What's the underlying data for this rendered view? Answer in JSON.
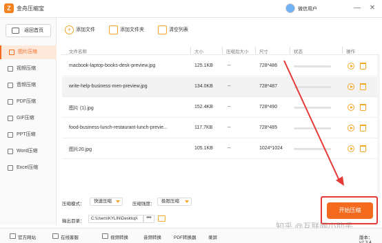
{
  "app": {
    "title": "金舟压缩宝",
    "logo_text": "Z"
  },
  "user": {
    "name": "微信用户"
  },
  "window_controls": {
    "minimize": "—",
    "close": "✕"
  },
  "sidebar": {
    "back_label": "返回首页",
    "items": [
      {
        "label": "图片压缩",
        "active": true
      },
      {
        "label": "视频压缩"
      },
      {
        "label": "音频压缩"
      },
      {
        "label": "PDF压缩"
      },
      {
        "label": "GIF压缩"
      },
      {
        "label": "PPT压缩"
      },
      {
        "label": "Word压缩"
      },
      {
        "label": "Excel压缩"
      }
    ]
  },
  "toolbar": {
    "add_file": "添加文件",
    "add_folder": "添加文件夹",
    "clear_list": "清空列表"
  },
  "table": {
    "headers": [
      "文件名称",
      "大小",
      "压缩后大小",
      "尺寸",
      "状态",
      "操作"
    ],
    "rows": [
      {
        "name": "macbook-laptop-books-desk-preview.jpg",
        "size": "125.1KB",
        "compressed": "--",
        "dims": "728*486"
      },
      {
        "name": "write-help-business-men-preview.jpg",
        "size": "134.0KB",
        "compressed": "--",
        "dims": "728*487",
        "selected": true
      },
      {
        "name": "图片 (1).jpg",
        "size": "152.4KB",
        "compressed": "--",
        "dims": "728*490"
      },
      {
        "name": "food-business-lunch-restaurant-lunch-previe...",
        "size": "117.7KB",
        "compressed": "--",
        "dims": "728*485"
      },
      {
        "name": "图片20.jpg",
        "size": "105.1KB",
        "compressed": "--",
        "dims": "1024*1024"
      }
    ]
  },
  "options": {
    "mode_label": "压缩模式：",
    "mode_value": "快速压缩",
    "strength_label": "压缩强度：",
    "strength_value": "极限压缩",
    "output_label": "输出目录：",
    "output_path": "C:\\Users\\KYLIN\\Desktop\\",
    "output_more": "•••"
  },
  "start_button": "开始压缩",
  "watermark": "知乎 @互联网小助手",
  "footer": {
    "items": [
      "官方网站",
      "在线客服",
      "视频转换",
      "音频转换",
      "PDF转换器",
      "录屏"
    ],
    "version": "版本：v2.3.4"
  },
  "colors": {
    "accent": "#f46a1f",
    "icon": "#f5a623",
    "highlight": "#e53935"
  }
}
